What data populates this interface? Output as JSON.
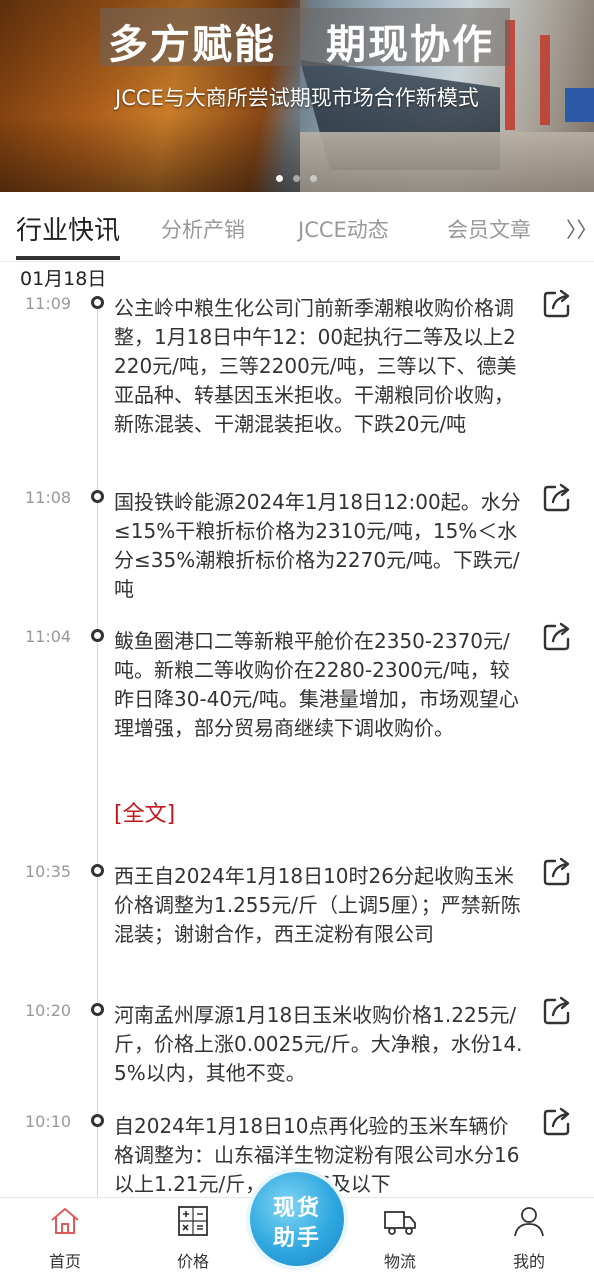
{
  "banner": {
    "title_part1": "多方赋能",
    "title_part2": "期现协作",
    "subtitle": "JCCE与大商所尝试期现市场合作新模式"
  },
  "tabs": [
    {
      "label": "行业快讯",
      "active": true
    },
    {
      "label": "分析产销",
      "active": false
    },
    {
      "label": "JCCE动态",
      "active": false
    },
    {
      "label": "会员文章",
      "active": false
    }
  ],
  "tabs_more_label": "〉〉",
  "date_header": "01月18日",
  "news": [
    {
      "time": "11:09",
      "text": "公主岭中粮生化公司门前新季潮粮收购价格调整，1月18日中午12：00起执行二等及以上2220元/吨，三等2200元/吨，三等以下、德美亚品种、转基因玉米拒收。干潮粮同价收购，新陈混装、干潮混装拒收。下跌20元/吨"
    },
    {
      "time": "11:08",
      "text": "国投铁岭能源2024年1月18日12:00起。水分≤15%干粮折标价格为2310元/吨，15%＜水分≤35%潮粮折标价格为2270元/吨。下跌元/吨"
    },
    {
      "time": "11:04",
      "text": "鲅鱼圈港口二等新粮平舱价在2350-2370元/吨。新粮二等收购价在2280-2300元/吨，较昨日降30-40元/吨。集港量增加，市场观望心理增强，部分贸易商继续下调收购价。",
      "link": "[全文]"
    },
    {
      "time": "10:35",
      "text": "西王自2024年1月18日10时26分起收购玉米价格调整为1.255元/斤（上调5厘）；严禁新陈混装；谢谢合作，西王淀粉有限公司"
    },
    {
      "time": "10:20",
      "text": "河南孟州厚源1月18日玉米收购价格1.225元/斤，价格上涨0.0025元/斤。大净粮，水份14.5%以内，其他不变。"
    },
    {
      "time": "10:10",
      "text": "自2024年1月18日10点再化验的玉米车辆价格调整为：山东福洋生物淀粉有限公司水分16以上1.21元/斤，水分16及以下"
    }
  ],
  "bottom_nav": [
    {
      "label": "首页",
      "icon": "home-icon",
      "active": true
    },
    {
      "label": "价格",
      "icon": "calculator-icon",
      "active": false
    },
    {
      "label": "物流",
      "icon": "truck-icon",
      "active": false
    },
    {
      "label": "我的",
      "icon": "user-icon",
      "active": false
    }
  ],
  "fab": {
    "line1": "现货",
    "line2": "助手"
  },
  "colors": {
    "accent_red": "#c0191c",
    "fab_blue": "#2fa7df",
    "home_active": "#e05a5a"
  }
}
